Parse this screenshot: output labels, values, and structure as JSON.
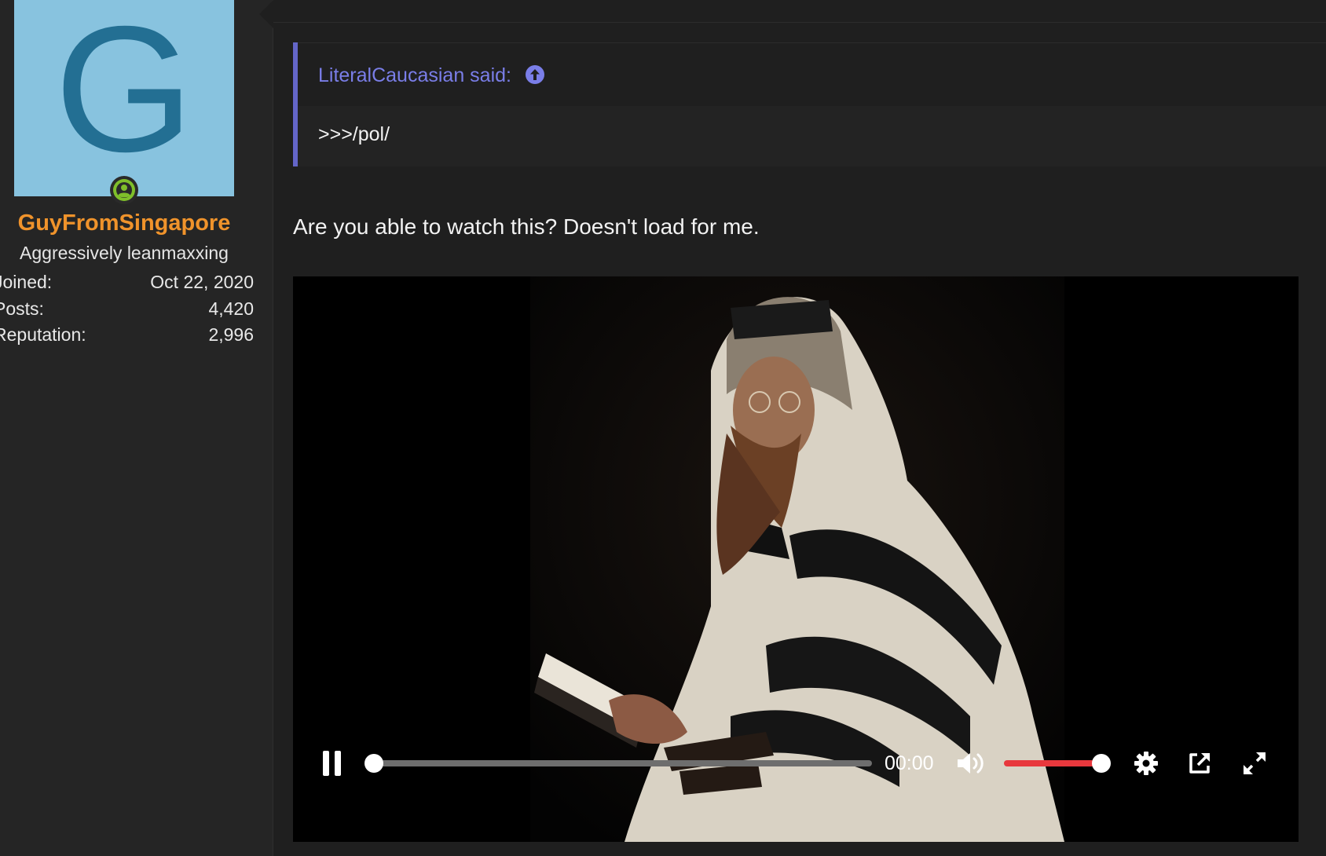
{
  "user": {
    "avatar_letter": "G",
    "avatar_bg": "#88c3df",
    "avatar_fg": "#236f93",
    "username": "GuyFromSingapore",
    "title": "Aggressively leanmaxxing",
    "online_icon": "user-online-icon",
    "stats": [
      {
        "label": "Joined:",
        "value": "Oct 22, 2020"
      },
      {
        "label": "Posts:",
        "value": "4,420"
      },
      {
        "label": "Reputation:",
        "value": "2,996"
      }
    ]
  },
  "quote": {
    "author": "LiteralCaucasian said:",
    "icon": "arrow-up-circle-icon",
    "body": ">>>/pol/"
  },
  "post": {
    "text": "Are you able to watch this? Doesn't load for me."
  },
  "video": {
    "time": "00:00",
    "progress": 0,
    "volume": 1.0,
    "icons": [
      "pause-icon",
      "volume-icon",
      "settings-icon",
      "popout-icon",
      "fullscreen-icon"
    ]
  },
  "colors": {
    "username": "#f0932b",
    "quote_accent": "#6466c8",
    "volume_fill": "#e8383d",
    "online": "#7fbf2a"
  }
}
